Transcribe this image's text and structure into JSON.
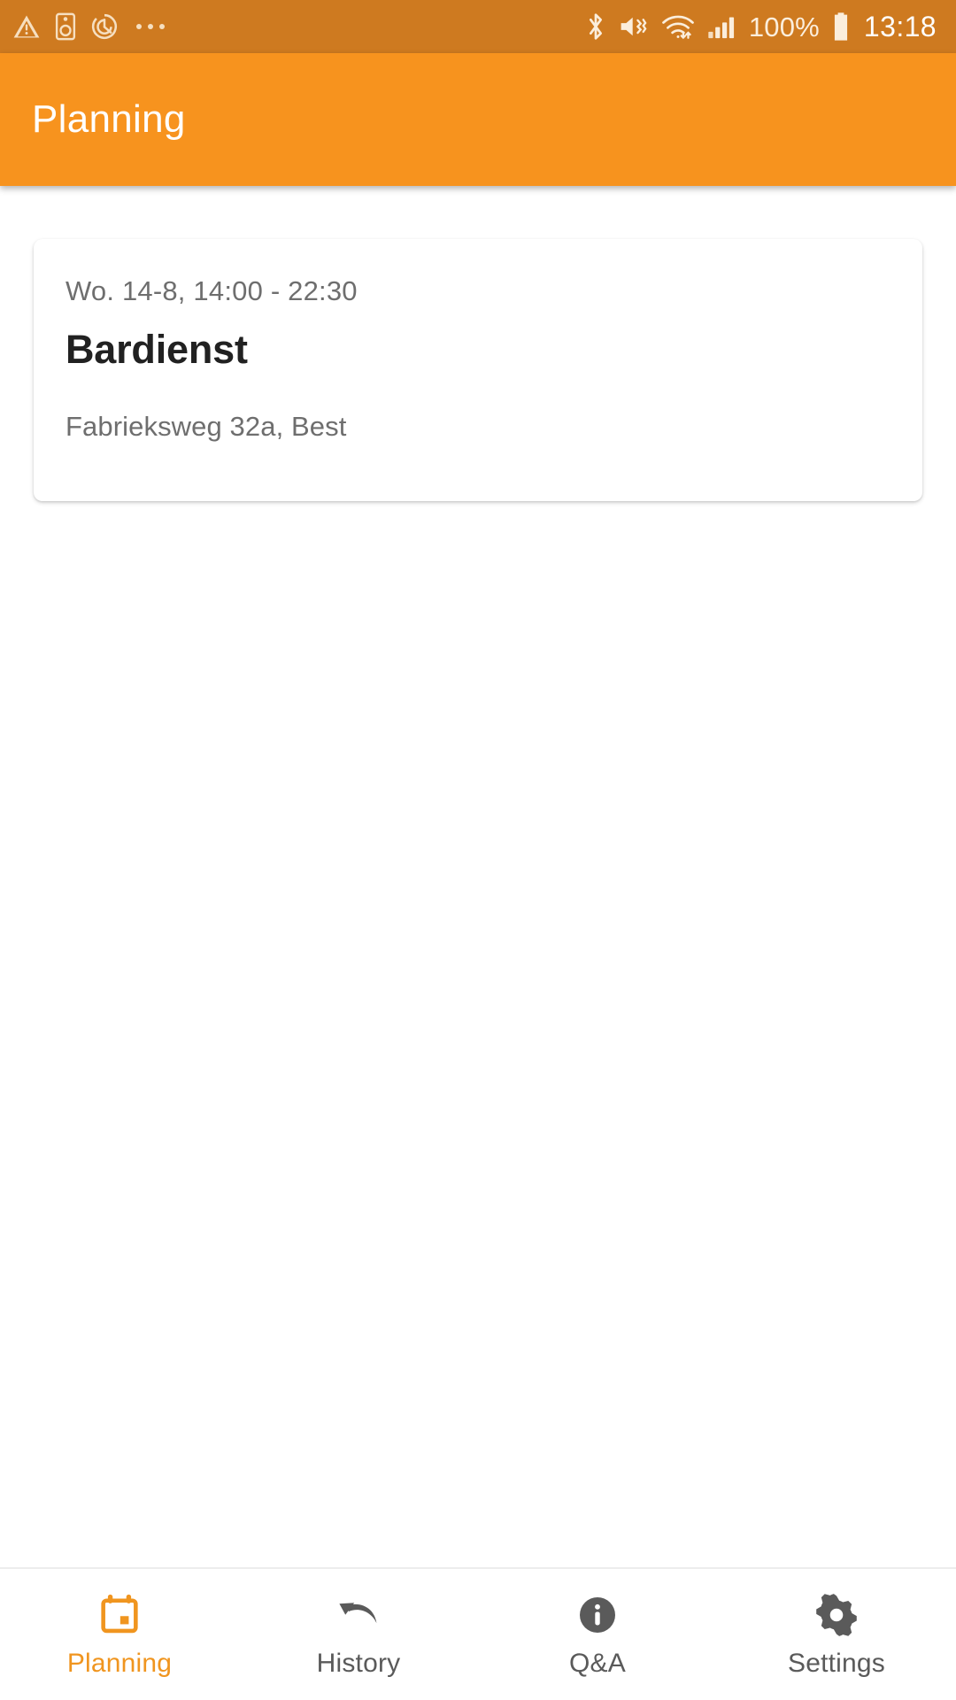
{
  "theme": {
    "status_bar_color": "#CE7A20",
    "app_bar_color": "#F7931E",
    "accent_color": "#F0951F",
    "page_background": "#FFFFFF",
    "card_background": "#FFFFFF",
    "primary_text_color": "#212121",
    "secondary_text_color": "#6E6E6E",
    "nav_inactive_color": "#5A5A5A"
  },
  "status_bar": {
    "left_icons": [
      {
        "name": "warning-triangle-icon",
        "label": "Warning"
      },
      {
        "name": "speaker-icon",
        "label": "Speaker"
      },
      {
        "name": "alarm-timer-icon",
        "label": "Alarm"
      },
      {
        "name": "more-notifications-icon",
        "label": "More notifications"
      }
    ],
    "right_icons": [
      {
        "name": "bluetooth-icon",
        "label": "Bluetooth"
      },
      {
        "name": "mute-icon",
        "label": "Sound muted"
      },
      {
        "name": "wifi-icon",
        "label": "Wi-Fi with data transfer"
      },
      {
        "name": "cellular-signal-icon",
        "label": "Cellular signal"
      },
      {
        "name": "battery-icon",
        "label": "Battery full"
      }
    ],
    "battery_percent": "100%",
    "clock": "13:18"
  },
  "app_bar": {
    "title": "Planning"
  },
  "shift_card": {
    "time": "Wo. 14-8, 14:00 - 22:30",
    "title": "Bardienst",
    "address": "Fabrieksweg 32a, Best"
  },
  "bottom_nav": {
    "items": [
      {
        "label": "Planning",
        "icon": "calendar-icon",
        "active": true
      },
      {
        "label": "History",
        "icon": "undo-arrow-icon",
        "active": false
      },
      {
        "label": "Q&A",
        "icon": "info-circle-icon",
        "active": false
      },
      {
        "label": "Settings",
        "icon": "gear-icon",
        "active": false
      }
    ]
  }
}
